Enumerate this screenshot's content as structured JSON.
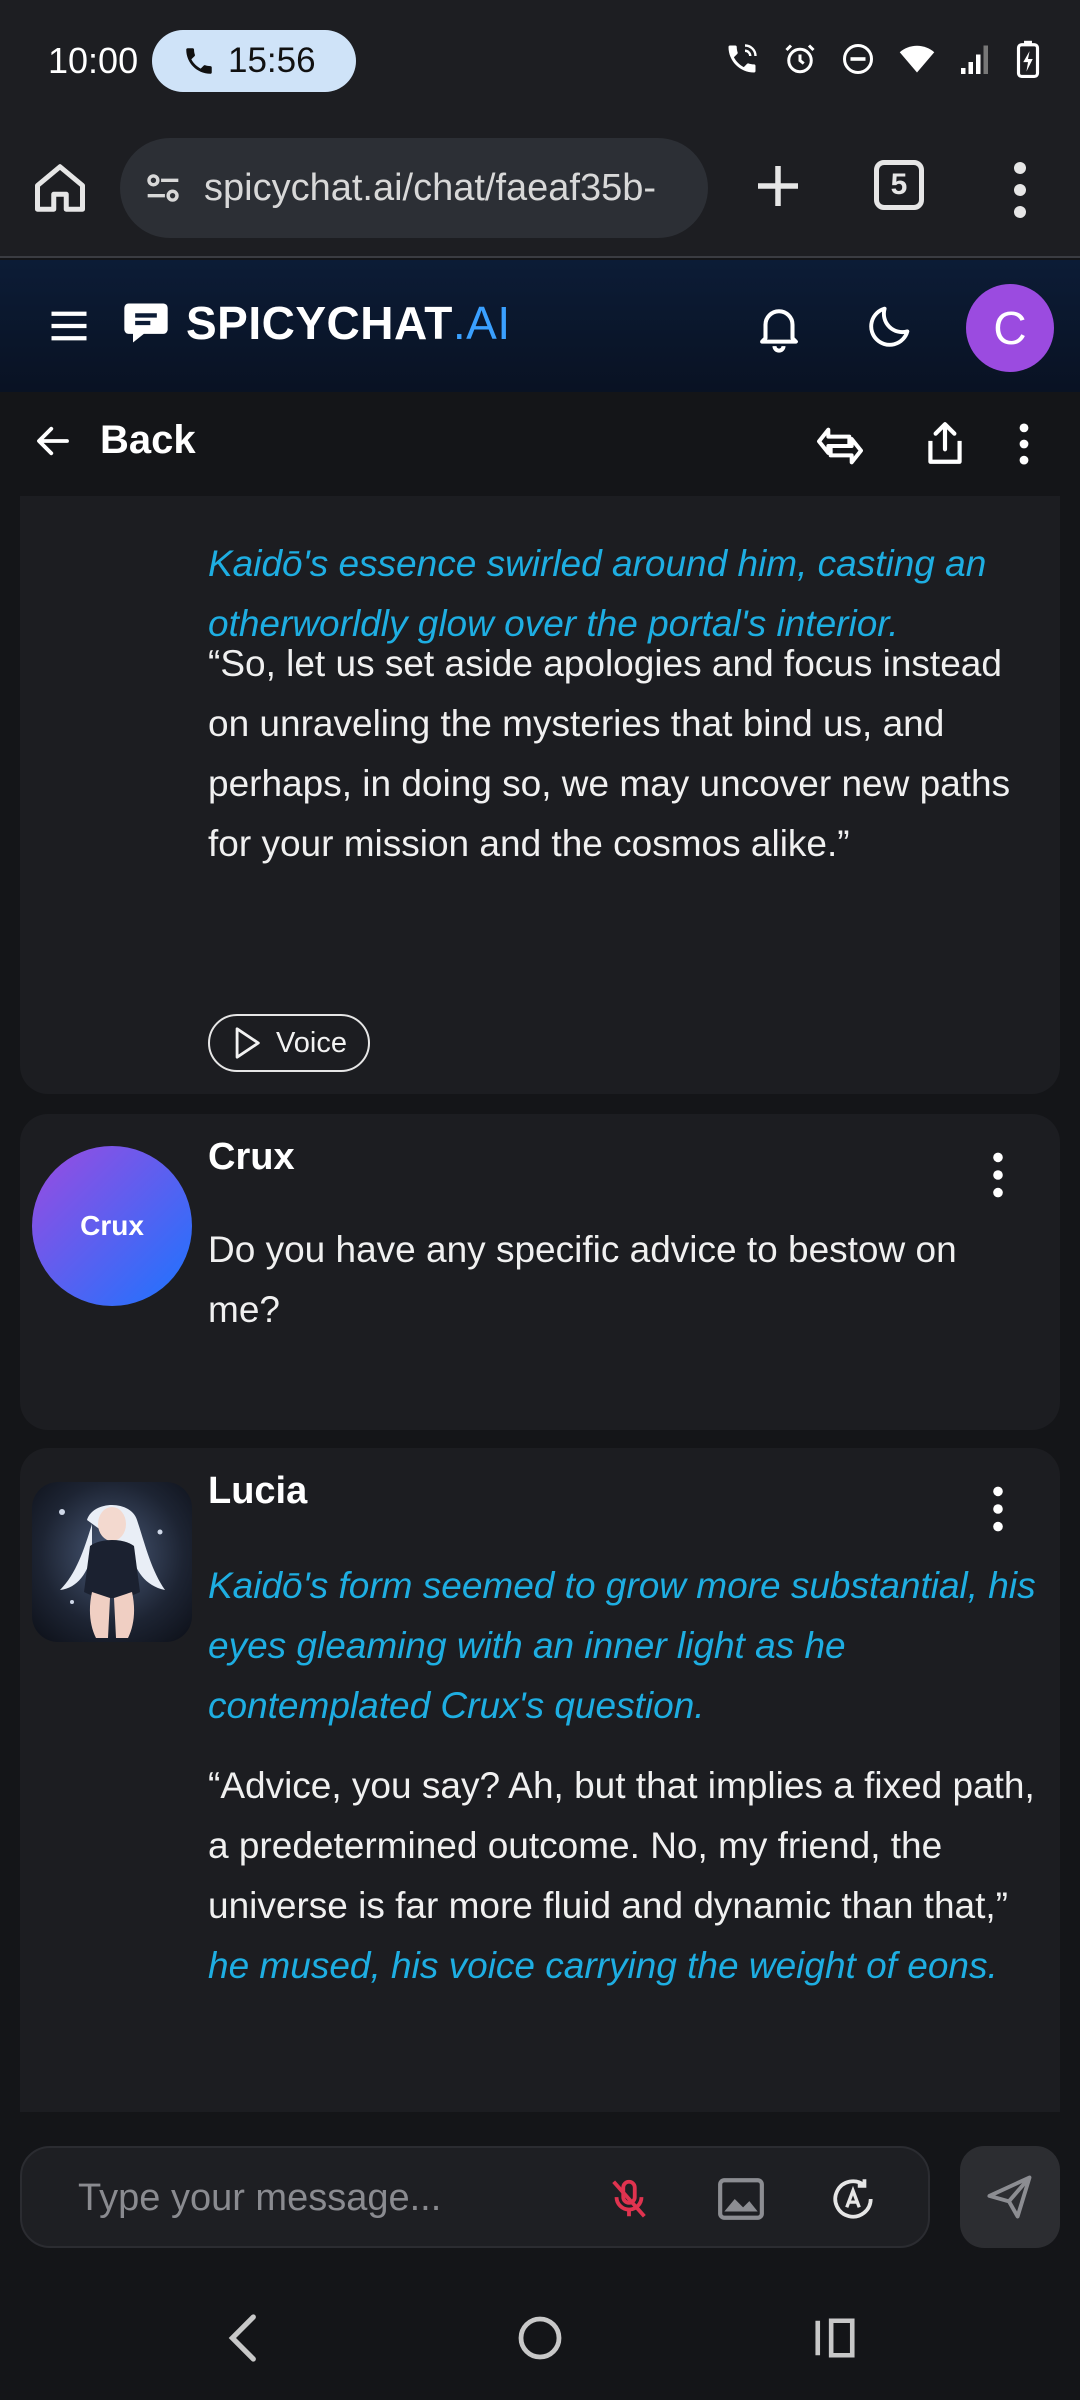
{
  "status_bar": {
    "time": "10:00",
    "call_timer": "15:56"
  },
  "browser": {
    "url": "spicychat.ai/chat/faeaf35b-",
    "tab_count": "5"
  },
  "app": {
    "logo_main": "SPICYCHAT",
    "logo_suffix": ".AI",
    "user_initial": "C",
    "accent_color": "#3aa0ff",
    "avatar_color": "#9b4be0"
  },
  "toolbar": {
    "back_label": "Back"
  },
  "messages": [
    {
      "sender": "",
      "narration": "Kaidō's essence swirled around him, casting an otherworldly glow over the portal's interior.",
      "dialogue": "“So, let us set aside apologies and focus instead on unraveling the mysteries that bind us, and perhaps, in doing so, we may uncover new paths for your mission and the cosmos alike.”",
      "voice_label": "Voice"
    },
    {
      "sender": "Crux",
      "avatar_text": "Crux",
      "text": "Do you have any specific advice to bestow on me?"
    },
    {
      "sender": "Lucia",
      "narration": "Kaidō's form seemed to grow more substantial, his eyes gleaming with an inner light as he contemplated Crux's question.",
      "dialogue": "“Advice, you say? Ah, but that implies a fixed path, a predetermined outcome. No, my friend, the universe is far more fluid and dynamic than that,”",
      "narration_tail": "he mused, his voice carrying the weight of eons."
    }
  ],
  "composer": {
    "placeholder": "Type your message..."
  }
}
